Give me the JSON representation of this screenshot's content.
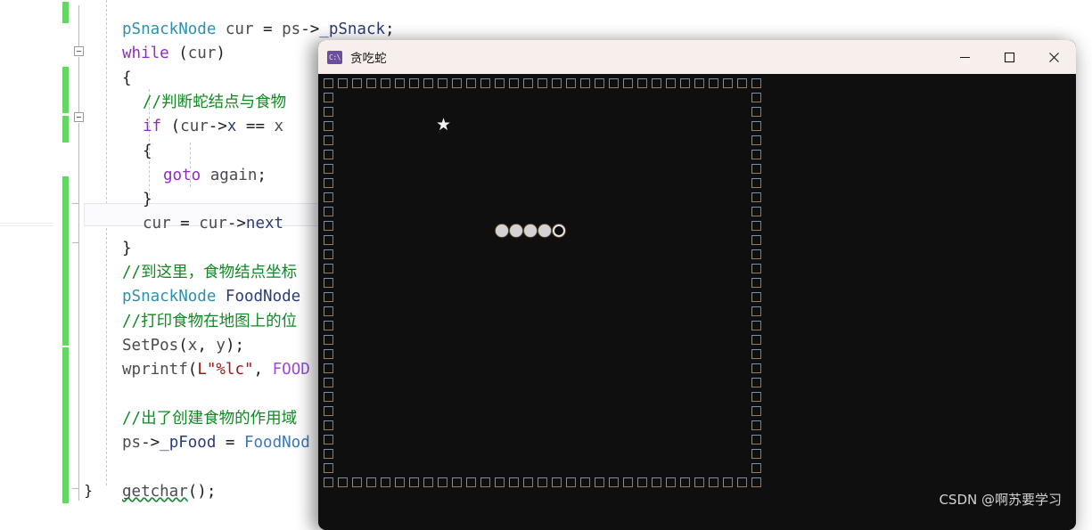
{
  "editor": {
    "name": "visual-studio-code-editor",
    "background_color": "#ffffff",
    "code_lines": [
      {
        "indent": 0,
        "tokens": [
          {
            "text": "pSnackNode",
            "cls": "tok-type"
          },
          {
            "text": " cur ",
            "cls": "tok-var"
          },
          {
            "text": "= ",
            "cls": "tok-punct"
          },
          {
            "text": "ps",
            "cls": "tok-var"
          },
          {
            "text": "->",
            "cls": "tok-punct"
          },
          {
            "text": "_pSnack",
            "cls": "tok-id"
          },
          {
            "text": ";",
            "cls": "tok-punct"
          }
        ]
      },
      {
        "indent": 0,
        "tokens": [
          {
            "text": "while",
            "cls": "tok-kw"
          },
          {
            "text": " (",
            "cls": "tok-punct"
          },
          {
            "text": "cur",
            "cls": "tok-var"
          },
          {
            "text": ")",
            "cls": "tok-punct"
          }
        ]
      },
      {
        "indent": 0,
        "tokens": [
          {
            "text": "{",
            "cls": "tok-punct"
          }
        ]
      },
      {
        "indent": 1,
        "tokens": [
          {
            "text": "//判断蛇结点与食物",
            "cls": "tok-comment"
          }
        ]
      },
      {
        "indent": 1,
        "tokens": [
          {
            "text": "if",
            "cls": "tok-kw"
          },
          {
            "text": " (",
            "cls": "tok-punct"
          },
          {
            "text": "cur",
            "cls": "tok-var"
          },
          {
            "text": "->",
            "cls": "tok-punct"
          },
          {
            "text": "x",
            "cls": "tok-id"
          },
          {
            "text": " == ",
            "cls": "tok-punct"
          },
          {
            "text": "x",
            "cls": "tok-var"
          }
        ]
      },
      {
        "indent": 1,
        "tokens": [
          {
            "text": "{",
            "cls": "tok-punct"
          }
        ]
      },
      {
        "indent": 2,
        "tokens": [
          {
            "text": "goto",
            "cls": "tok-kw"
          },
          {
            "text": " ",
            "cls": "tok-punct"
          },
          {
            "text": "again",
            "cls": "tok-var"
          },
          {
            "text": ";",
            "cls": "tok-punct"
          }
        ]
      },
      {
        "indent": 1,
        "tokens": [
          {
            "text": "}",
            "cls": "tok-punct"
          }
        ]
      },
      {
        "indent": 1,
        "tokens": [
          {
            "text": "cur",
            "cls": "tok-var"
          },
          {
            "text": " = ",
            "cls": "tok-punct"
          },
          {
            "text": "cur",
            "cls": "tok-var"
          },
          {
            "text": "->",
            "cls": "tok-punct"
          },
          {
            "text": "next",
            "cls": "tok-id"
          }
        ]
      },
      {
        "indent": 0,
        "tokens": [
          {
            "text": "}",
            "cls": "tok-punct"
          }
        ]
      },
      {
        "indent": 0,
        "tokens": [
          {
            "text": "//到这里，食物结点坐标",
            "cls": "tok-comment"
          }
        ]
      },
      {
        "indent": 0,
        "tokens": [
          {
            "text": "pSnackNode",
            "cls": "tok-type"
          },
          {
            "text": " ",
            "cls": "tok-punct"
          },
          {
            "text": "FoodNode",
            "cls": "tok-id"
          }
        ]
      },
      {
        "indent": 0,
        "tokens": [
          {
            "text": "//打印食物在地图上的位",
            "cls": "tok-comment"
          }
        ]
      },
      {
        "indent": 0,
        "tokens": [
          {
            "text": "SetPos",
            "cls": "tok-var"
          },
          {
            "text": "(",
            "cls": "tok-punct"
          },
          {
            "text": "x",
            "cls": "tok-var"
          },
          {
            "text": ", ",
            "cls": "tok-punct"
          },
          {
            "text": "y",
            "cls": "tok-var"
          },
          {
            "text": ");",
            "cls": "tok-punct"
          }
        ]
      },
      {
        "indent": 0,
        "tokens": [
          {
            "text": "wprintf",
            "cls": "tok-var"
          },
          {
            "text": "(",
            "cls": "tok-punct"
          },
          {
            "text": "L",
            "cls": "tok-str"
          },
          {
            "text": "\"%lc\"",
            "cls": "tok-str"
          },
          {
            "text": ", ",
            "cls": "tok-punct"
          },
          {
            "text": "FOOD",
            "cls": "tok-macro"
          }
        ]
      },
      {
        "indent": 0,
        "tokens": []
      },
      {
        "indent": 0,
        "tokens": [
          {
            "text": "//出了创建食物的作用域",
            "cls": "tok-comment"
          }
        ]
      },
      {
        "indent": 0,
        "tokens": [
          {
            "text": "ps",
            "cls": "tok-var"
          },
          {
            "text": "->",
            "cls": "tok-punct"
          },
          {
            "text": "_pFood",
            "cls": "tok-id"
          },
          {
            "text": " = ",
            "cls": "tok-punct"
          },
          {
            "text": "FoodNod",
            "cls": "tok-blue"
          }
        ]
      },
      {
        "indent": 0,
        "tokens": []
      },
      {
        "indent": 0,
        "tokens": [
          {
            "text": "getchar",
            "cls": "tok-var squiggle"
          },
          {
            "text": "();",
            "cls": "tok-punct"
          }
        ]
      }
    ],
    "closing_brace": "}",
    "gutter": {
      "change_bar_color": "#62d862",
      "collapse_marker": "minus-box"
    }
  },
  "console_window": {
    "name": "snake-game-console",
    "title": "贪吃蛇",
    "icon_label": "C:\\",
    "icon_name": "console-app-icon",
    "titlebar_color": "#f7efeb",
    "canvas_color": "#100f10",
    "controls": {
      "minimize": "—",
      "maximize": "☐",
      "close": "✕"
    }
  },
  "game": {
    "wall_glyph": "□",
    "wall_color": "#7b8fa8",
    "food_glyph": "★",
    "food_label": "food-star",
    "snake_body_glyph": "●",
    "snake_head_glyph": "○",
    "snake_body_count": 4,
    "wall_cols": 31,
    "wall_rows": 29,
    "food_cell": {
      "col": 8,
      "row": 2
    },
    "snake_cells": [
      {
        "col": 12,
        "row": 4
      },
      {
        "col": 13,
        "row": 4
      },
      {
        "col": 14,
        "row": 4
      },
      {
        "col": 15,
        "row": 4
      },
      {
        "col": 16,
        "row": 4
      }
    ]
  },
  "watermark": {
    "text": "CSDN @啊苏要学习"
  }
}
